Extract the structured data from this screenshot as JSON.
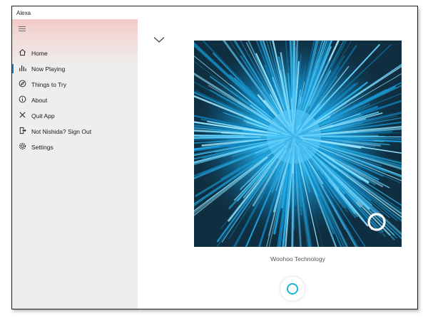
{
  "app": {
    "title": "Alexa"
  },
  "sidebar": {
    "items": [
      {
        "label": "Home",
        "icon": "home-icon"
      },
      {
        "label": "Now Playing",
        "icon": "bar-chart-icon",
        "active": true
      },
      {
        "label": "Things to Try",
        "icon": "compass-icon"
      },
      {
        "label": "About",
        "icon": "info-icon"
      },
      {
        "label": "Quit App",
        "icon": "close-icon"
      },
      {
        "label": "Not Nishida? Sign Out",
        "icon": "sign-out-icon"
      },
      {
        "label": "Settings",
        "icon": "gear-icon"
      }
    ]
  },
  "now_playing": {
    "caption": "Woohoo Technology",
    "art_logo": "alexa-ring-icon"
  },
  "voice_button": {
    "icon": "alexa-ring-icon"
  },
  "colors": {
    "accent": "#1f80c9",
    "alexa_cyan": "#19b5da",
    "art_background": "#0f2e3f",
    "sidebar_bg": "#ececec"
  }
}
